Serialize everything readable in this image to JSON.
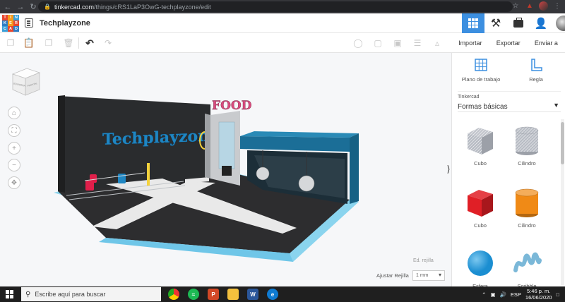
{
  "browser": {
    "url_host": "tinkercad.com",
    "url_path": "/things/cRS1LaP3OwG-techplayzone/edit",
    "icons": [
      "back-icon",
      "forward-icon",
      "reload-icon",
      "lock-icon",
      "star-icon",
      "extension-icon",
      "menu-icon"
    ]
  },
  "app": {
    "logo_letters": [
      "T",
      "I",
      "N",
      "K",
      "E",
      "R",
      "C",
      "A",
      "D"
    ],
    "logo_colors": [
      "#e8472f",
      "#f59b1c",
      "#3a9fd8",
      "#2e7dc4",
      "#f59b1c",
      "#e8472f",
      "#3a9fd8",
      "#e8472f",
      "#2e7dc4"
    ],
    "project_title": "Techplayzone"
  },
  "toolbar": {
    "import_label": "Importar",
    "export_label": "Exportar",
    "send_label": "Enviar a"
  },
  "canvas": {
    "viewcube_top": "SUPERIOR",
    "viewcube_left": "IZQUIERDA",
    "viewcube_front": "FRONTAL",
    "scene_sign_text": "Techplayzone",
    "scene_food_text": "FOOD",
    "grid_edit_label": "Ed. rejilla",
    "snap_grid_label": "Ajustar Rejilla",
    "snap_grid_value": "1 mm"
  },
  "panel": {
    "workplane_label": "Plano de trabajo",
    "ruler_label": "Regla",
    "library_source": "Tinkercad",
    "library_category": "Formas básicas",
    "shapes": [
      {
        "label": "Cubo",
        "color": "#b8bcc4",
        "kind": "box",
        "striped": true
      },
      {
        "label": "Cilindro",
        "color": "#b8bcc4",
        "kind": "cyl",
        "striped": true
      },
      {
        "label": "Cubo",
        "color": "#e01f26",
        "kind": "box",
        "striped": false
      },
      {
        "label": "Cilindro",
        "color": "#f08a16",
        "kind": "cyl",
        "striped": false
      },
      {
        "label": "Esfera",
        "color": "#1b8ed1",
        "kind": "sphere",
        "striped": false
      },
      {
        "label": "Scribble",
        "color": "#7bb8d8",
        "kind": "scribble",
        "striped": false
      }
    ]
  },
  "taskbar": {
    "search_placeholder": "Escribe aquí para buscar",
    "language": "ESP",
    "time": "5:46 p. m.",
    "date": "16/06/2020"
  }
}
